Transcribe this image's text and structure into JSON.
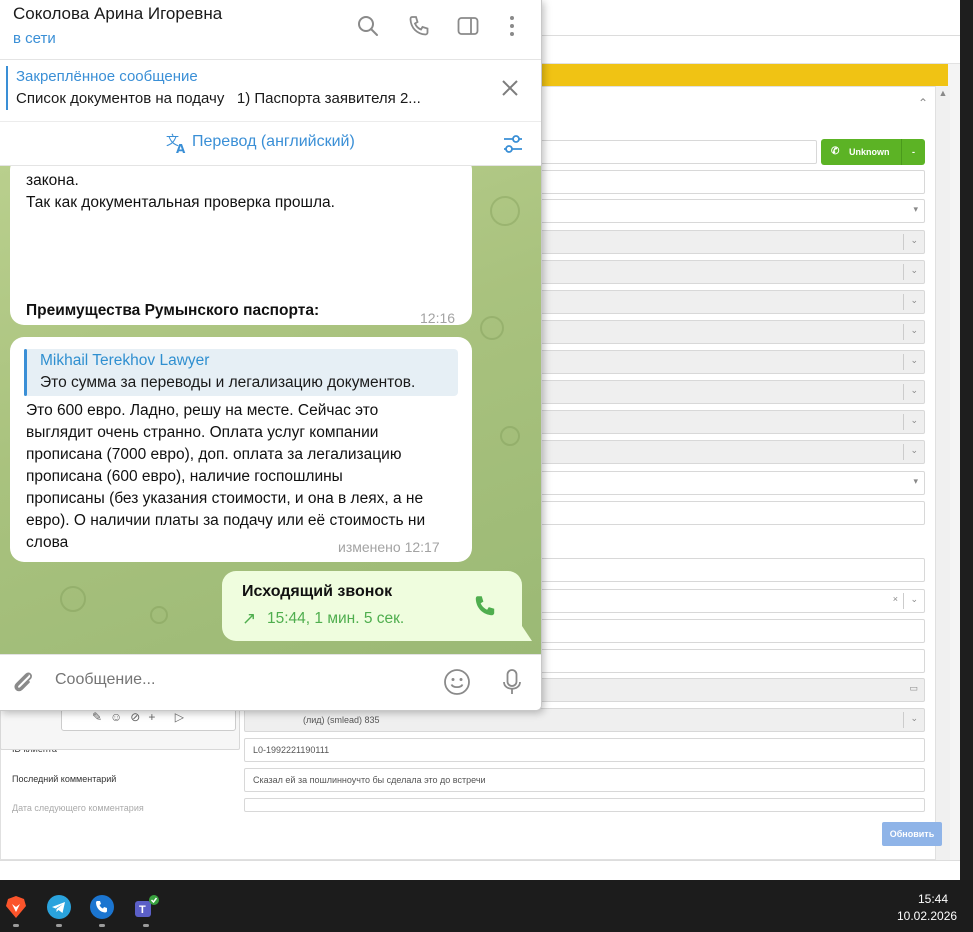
{
  "telegram": {
    "chat_name": "Соколова Арина Игоревна",
    "status": "в сети",
    "pinned": {
      "title": "Закреплённое сообщение",
      "text": "Список документов на подачу   1) Паспорта заявителя 2..."
    },
    "translate_label": "Перевод (английский)",
    "messages": [
      {
        "line1": "закона.",
        "line2": "Так как документальная проверка прошла.",
        "line3": "Преимущества Румынского паспорта:",
        "time": "12:16"
      },
      {
        "reply_name": "Mikhail Terekhov Lawyer",
        "reply_text": "Это сумма за переводы и легализацию документов.",
        "lines": [
          "Это 600 евро. Ладно, решу на месте. Сейчас это",
          "выглядит очень странно. Оплата услуг компании",
          "прописана (7000 евро), доп. оплата за легализацию",
          "прописана (600 евро), наличие госпошлины",
          "прописаны (без указания стоимости, и она в леях, а не",
          "евро). О наличии платы за подачу или её стоимость ни",
          "слова"
        ],
        "time": "изменено 12:17"
      }
    ],
    "call": {
      "title": "Исходящий звонок",
      "arrow": "↗",
      "info": "15:44, 1 мин. 5 сек."
    },
    "composer_placeholder": "Сообщение..."
  },
  "crm": {
    "unknown_label": "Unknown",
    "unknown_drop": "-",
    "fields": {
      "lead_value": "(лид) (smlead) 835",
      "id_value": "L0-1992221190111",
      "last_comment_label": "Последний комментарий",
      "last_comment_value": "Сказал ей за пошлинноучто бы сделала это до встречи",
      "id_label": "ID клиента",
      "next_label": "Дата следующего комментария"
    },
    "update_button": "Обновить"
  },
  "taskbar": {
    "time": "15:44",
    "date": "10.02.2026"
  },
  "colors": {
    "accent": "#3a8fd6",
    "call_green": "#4fae4e",
    "crm_green": "#5cb325",
    "crm_yellow": "#f0c314"
  }
}
